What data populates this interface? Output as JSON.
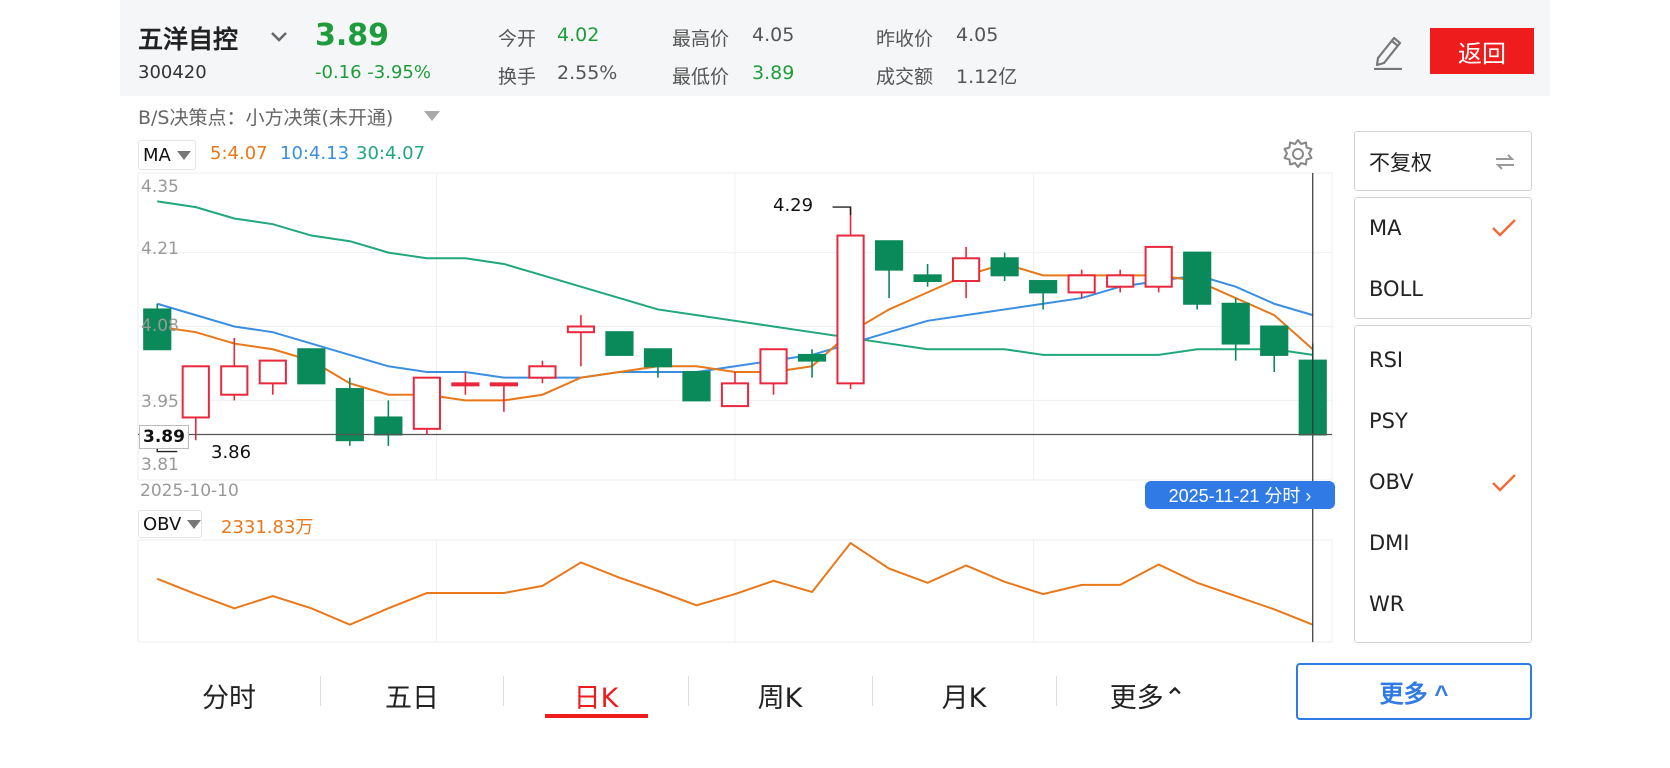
{
  "header": {
    "stock_name": "五洋自控",
    "stock_code": "300420",
    "price": "3.89",
    "change": "-0.16 -3.95%",
    "open_label": "今开",
    "open_value": "4.02",
    "turnover_label": "换手",
    "turnover_value": "2.55%",
    "high_label": "最高价",
    "high_value": "4.05",
    "low_label": "最低价",
    "low_value": "3.89",
    "prev_close_label": "昨收价",
    "prev_close_value": "4.05",
    "amount_label": "成交额",
    "amount_value": "1.12亿",
    "back_label": "返回"
  },
  "decision": {
    "text": "B/S决策点：小方决策(未开通)"
  },
  "indicators": {
    "main_name": "MA",
    "ma5": "5:4.07",
    "ma10": "10:4.13",
    "ma30": "30:4.07",
    "sub_name": "OBV",
    "sub_value": "2331.83万"
  },
  "chart_labels": {
    "y_ticks": [
      "4.35",
      "4.21",
      "4.08",
      "3.95",
      "3.81"
    ],
    "current_price_tag": "3.89",
    "high_marker": "4.29",
    "low_marker": "3.86",
    "start_date": "2025-10-10",
    "cursor_date_button": "2025-11-21 分时 ›"
  },
  "colors": {
    "up": "#e8283c",
    "down": "#0a8a5a",
    "ma5": "#e8781a",
    "ma10": "#3b8fe0",
    "ma30": "#20a879",
    "accent_red": "#ee1c1c",
    "accent_blue": "#2f7ae5"
  },
  "chart_data": {
    "type": "candlestick",
    "y_range": [
      3.81,
      4.35
    ],
    "start_date": "2025-10-10",
    "end_date": "2025-11-21",
    "candles": [
      {
        "o": 4.11,
        "h": 4.12,
        "l": 4.06,
        "c": 4.04
      },
      {
        "o": 3.92,
        "h": 4.01,
        "l": 3.88,
        "c": 4.01
      },
      {
        "o": 3.96,
        "h": 4.06,
        "l": 3.95,
        "c": 4.01
      },
      {
        "o": 3.98,
        "h": 4.02,
        "l": 3.96,
        "c": 4.02
      },
      {
        "o": 4.04,
        "h": 4.04,
        "l": 3.98,
        "c": 3.98
      },
      {
        "o": 3.97,
        "h": 3.99,
        "l": 3.87,
        "c": 3.88
      },
      {
        "o": 3.92,
        "h": 3.95,
        "l": 3.87,
        "c": 3.89
      },
      {
        "o": 3.9,
        "h": 3.99,
        "l": 3.89,
        "c": 3.99
      },
      {
        "o": 3.98,
        "h": 4.0,
        "l": 3.96,
        "c": 3.98
      },
      {
        "o": 3.98,
        "h": 3.98,
        "l": 3.93,
        "c": 3.98
      },
      {
        "o": 3.99,
        "h": 4.02,
        "l": 3.98,
        "c": 4.01
      },
      {
        "o": 4.07,
        "h": 4.1,
        "l": 4.01,
        "c": 4.08
      },
      {
        "o": 4.07,
        "h": 4.07,
        "l": 4.03,
        "c": 4.03
      },
      {
        "o": 4.04,
        "h": 4.04,
        "l": 3.99,
        "c": 4.01
      },
      {
        "o": 4.0,
        "h": 4.0,
        "l": 3.95,
        "c": 3.95
      },
      {
        "o": 3.94,
        "h": 4.0,
        "l": 3.94,
        "c": 3.98
      },
      {
        "o": 3.98,
        "h": 4.04,
        "l": 3.96,
        "c": 4.04
      },
      {
        "o": 4.03,
        "h": 4.04,
        "l": 3.99,
        "c": 4.02
      },
      {
        "o": 3.98,
        "h": 4.29,
        "l": 3.97,
        "c": 4.24
      },
      {
        "o": 4.23,
        "h": 4.23,
        "l": 4.13,
        "c": 4.18
      },
      {
        "o": 4.17,
        "h": 4.19,
        "l": 4.15,
        "c": 4.16
      },
      {
        "o": 4.16,
        "h": 4.22,
        "l": 4.13,
        "c": 4.2
      },
      {
        "o": 4.2,
        "h": 4.21,
        "l": 4.16,
        "c": 4.17
      },
      {
        "o": 4.16,
        "h": 4.16,
        "l": 4.11,
        "c": 4.14
      },
      {
        "o": 4.14,
        "h": 4.18,
        "l": 4.13,
        "c": 4.17
      },
      {
        "o": 4.15,
        "h": 4.18,
        "l": 4.14,
        "c": 4.17
      },
      {
        "o": 4.15,
        "h": 4.22,
        "l": 4.14,
        "c": 4.22
      },
      {
        "o": 4.21,
        "h": 4.21,
        "l": 4.11,
        "c": 4.12
      },
      {
        "o": 4.12,
        "h": 4.13,
        "l": 4.02,
        "c": 4.05
      },
      {
        "o": 4.08,
        "h": 4.08,
        "l": 4.0,
        "c": 4.03
      },
      {
        "o": 4.02,
        "h": 4.05,
        "l": 3.89,
        "c": 3.89
      }
    ],
    "ma5": [
      4.08,
      4.07,
      4.05,
      4.04,
      4.02,
      3.98,
      3.96,
      3.96,
      3.95,
      3.95,
      3.96,
      3.99,
      4.0,
      4.01,
      4.01,
      4.0,
      4.0,
      4.01,
      4.07,
      4.11,
      4.14,
      4.17,
      4.19,
      4.17,
      4.17,
      4.17,
      4.17,
      4.16,
      4.13,
      4.1,
      4.04
    ],
    "ma10": [
      4.12,
      4.1,
      4.08,
      4.07,
      4.05,
      4.03,
      4.01,
      4.0,
      4.0,
      3.99,
      3.99,
      3.99,
      4.0,
      4.0,
      4.0,
      4.01,
      4.02,
      4.03,
      4.05,
      4.07,
      4.09,
      4.1,
      4.11,
      4.12,
      4.13,
      4.15,
      4.16,
      4.17,
      4.15,
      4.12,
      4.1
    ],
    "ma30": [
      4.3,
      4.29,
      4.27,
      4.26,
      4.24,
      4.23,
      4.21,
      4.2,
      4.2,
      4.19,
      4.17,
      4.15,
      4.13,
      4.11,
      4.1,
      4.09,
      4.08,
      4.07,
      4.06,
      4.05,
      4.04,
      4.04,
      4.04,
      4.03,
      4.03,
      4.03,
      4.03,
      4.04,
      4.04,
      4.04,
      4.03
    ],
    "obv": [
      62,
      47,
      33,
      45,
      33,
      17,
      33,
      48,
      48,
      48,
      55,
      78,
      63,
      50,
      36,
      47,
      60,
      49,
      97,
      72,
      58,
      75,
      59,
      47,
      56,
      56,
      76,
      58,
      45,
      32,
      17
    ]
  },
  "side_panel": {
    "adjust_label": "不复权",
    "main_options": [
      {
        "label": "MA",
        "checked": true
      },
      {
        "label": "BOLL",
        "checked": false
      }
    ],
    "sub_options": [
      {
        "label": "RSI",
        "checked": false
      },
      {
        "label": "PSY",
        "checked": false
      },
      {
        "label": "OBV",
        "checked": true
      },
      {
        "label": "DMI",
        "checked": false
      },
      {
        "label": "WR",
        "checked": false
      }
    ],
    "more_button": "更多 ^"
  },
  "tabs": [
    {
      "label": "分时",
      "active": false
    },
    {
      "label": "五日",
      "active": false
    },
    {
      "label": "日K",
      "active": true
    },
    {
      "label": "周K",
      "active": false
    },
    {
      "label": "月K",
      "active": false
    },
    {
      "label": "更多⌃",
      "active": false
    }
  ]
}
